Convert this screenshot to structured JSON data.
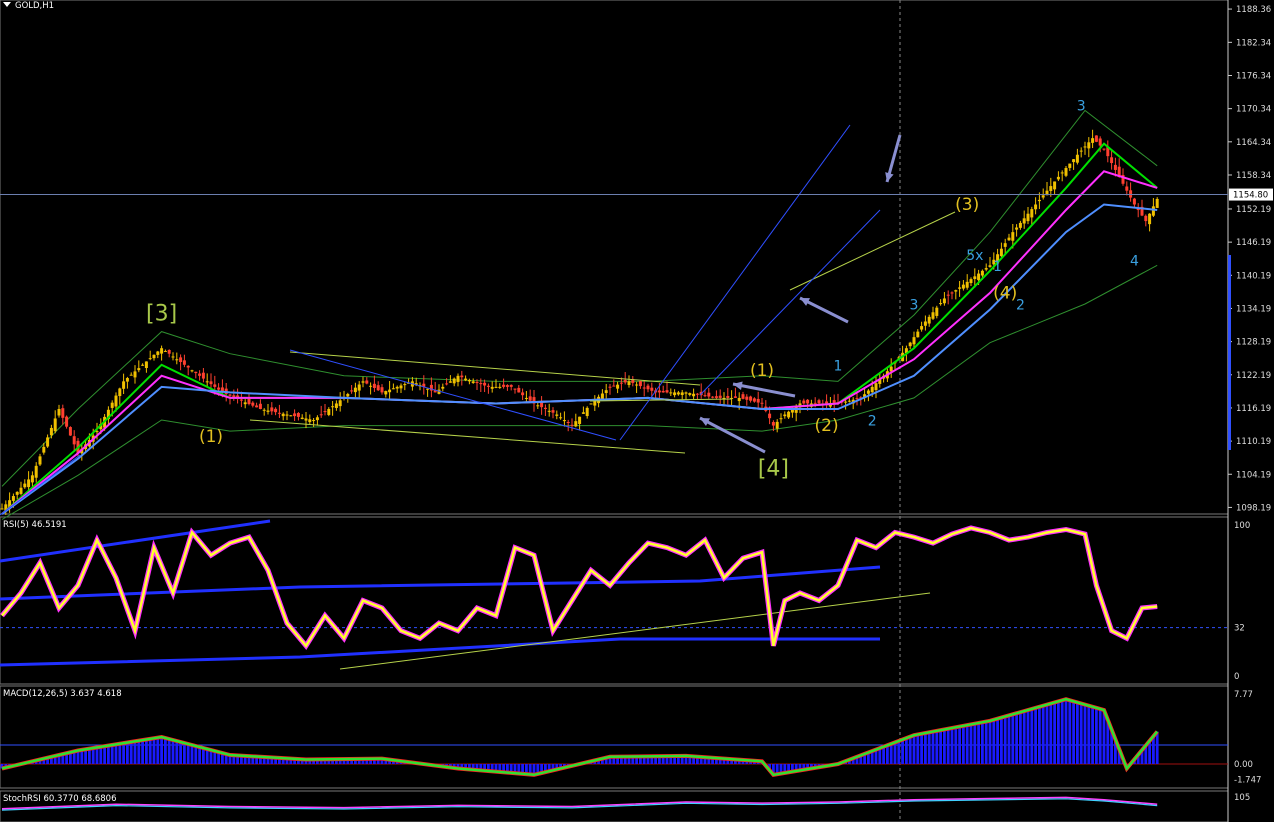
{
  "chart_data": [
    {
      "type": "candlestick",
      "title": "GOLD,H1",
      "price_ticks": [
        "1188.36",
        "1182.34",
        "1176.34",
        "1170.34",
        "1164.34",
        "1158.34",
        "1152.19",
        "1146.19",
        "1140.19",
        "1134.19",
        "1128.19",
        "1122.19",
        "1116.19",
        "1110.19",
        "1104.19",
        "1098.19"
      ],
      "price_tick_values": [
        1188.36,
        1182.34,
        1176.34,
        1170.34,
        1164.34,
        1158.34,
        1152.19,
        1146.19,
        1140.19,
        1134.19,
        1128.19,
        1122.19,
        1116.19,
        1110.19,
        1104.19,
        1098.19
      ],
      "current_price": "1154.80",
      "current_price_value": 1154.8,
      "ylim": [
        1097.0,
        1190.0
      ],
      "price_path": [
        [
          0,
          1098
        ],
        [
          8,
          1104
        ],
        [
          15,
          1116
        ],
        [
          20,
          1108
        ],
        [
          25,
          1112
        ],
        [
          32,
          1121
        ],
        [
          42,
          1127
        ],
        [
          50,
          1123
        ],
        [
          58,
          1119
        ],
        [
          68,
          1116
        ],
        [
          75,
          1115
        ],
        [
          82,
          1114
        ],
        [
          88,
          1117
        ],
        [
          95,
          1121
        ],
        [
          100,
          1119
        ],
        [
          108,
          1121
        ],
        [
          114,
          1119
        ],
        [
          120,
          1122
        ],
        [
          128,
          1120
        ],
        [
          134,
          1120
        ],
        [
          140,
          1117
        ],
        [
          146,
          1115
        ],
        [
          150,
          1113
        ],
        [
          155,
          1117
        ],
        [
          160,
          1120
        ],
        [
          165,
          1121
        ],
        [
          172,
          1119
        ],
        [
          180,
          1119
        ],
        [
          188,
          1118
        ],
        [
          194,
          1118
        ],
        [
          200,
          1117
        ],
        [
          203,
          1113
        ],
        [
          206,
          1115
        ],
        [
          210,
          1117
        ],
        [
          215,
          1117
        ],
        [
          220,
          1117
        ],
        [
          226,
          1118
        ],
        [
          232,
          1122
        ],
        [
          238,
          1127
        ],
        [
          242,
          1131
        ],
        [
          248,
          1136
        ],
        [
          254,
          1139
        ],
        [
          260,
          1142
        ],
        [
          266,
          1148
        ],
        [
          272,
          1153
        ],
        [
          278,
          1158
        ],
        [
          283,
          1162
        ],
        [
          287,
          1165
        ],
        [
          290,
          1163
        ],
        [
          294,
          1158
        ],
        [
          298,
          1153
        ],
        [
          301,
          1150
        ],
        [
          304,
          1154
        ]
      ],
      "bands": {
        "upper": [
          [
            0,
            1102
          ],
          [
            20,
            1116
          ],
          [
            42,
            1130
          ],
          [
            60,
            1126
          ],
          [
            90,
            1122
          ],
          [
            130,
            1121
          ],
          [
            170,
            1121
          ],
          [
            200,
            1122
          ],
          [
            220,
            1121
          ],
          [
            240,
            1133
          ],
          [
            260,
            1148
          ],
          [
            285,
            1170
          ],
          [
            304,
            1160
          ]
        ],
        "lower": [
          [
            0,
            1096
          ],
          [
            20,
            1104
          ],
          [
            42,
            1114
          ],
          [
            60,
            1112
          ],
          [
            90,
            1113
          ],
          [
            130,
            1113
          ],
          [
            170,
            1113
          ],
          [
            200,
            1112
          ],
          [
            220,
            1114
          ],
          [
            240,
            1118
          ],
          [
            260,
            1128
          ],
          [
            285,
            1135
          ],
          [
            304,
            1142
          ]
        ]
      },
      "moving_averages": [
        {
          "color": "#00e000",
          "values": [
            [
              0,
              1097
            ],
            [
              20,
              1109
            ],
            [
              42,
              1124
            ],
            [
              60,
              1118
            ],
            [
              90,
              1118
            ],
            [
              130,
              1117
            ],
            [
              170,
              1118
            ],
            [
              200,
              1116
            ],
            [
              220,
              1117
            ],
            [
              240,
              1127
            ],
            [
              260,
              1141
            ],
            [
              280,
              1156
            ],
            [
              290,
              1164
            ],
            [
              304,
              1156
            ]
          ]
        },
        {
          "color": "#ff30ff",
          "values": [
            [
              0,
              1097
            ],
            [
              20,
              1108
            ],
            [
              42,
              1122
            ],
            [
              60,
              1118
            ],
            [
              90,
              1118
            ],
            [
              130,
              1117
            ],
            [
              170,
              1118
            ],
            [
              200,
              1116
            ],
            [
              220,
              1117
            ],
            [
              240,
              1125
            ],
            [
              260,
              1137
            ],
            [
              280,
              1152
            ],
            [
              290,
              1159
            ],
            [
              304,
              1156
            ]
          ]
        },
        {
          "color": "#4f8fff",
          "values": [
            [
              0,
              1097
            ],
            [
              20,
              1107
            ],
            [
              42,
              1120
            ],
            [
              60,
              1119
            ],
            [
              90,
              1118
            ],
            [
              130,
              1117
            ],
            [
              170,
              1118
            ],
            [
              200,
              1116
            ],
            [
              220,
              1116
            ],
            [
              240,
              1122
            ],
            [
              260,
              1134
            ],
            [
              280,
              1148
            ],
            [
              290,
              1153
            ],
            [
              304,
              1152
            ]
          ]
        }
      ],
      "wave_labels": [
        {
          "text": "[3]",
          "color": "#a8c84a",
          "x": 42,
          "y": 1132
        },
        {
          "text": "(1)",
          "color": "#e2c020",
          "x": 55,
          "y": 1110
        },
        {
          "text": "(1)",
          "color": "#e2c020",
          "x": 200,
          "y": 1122
        },
        {
          "text": "[4]",
          "color": "#a8c84a",
          "x": 203,
          "y": 1104
        },
        {
          "text": "(2)",
          "color": "#e2c020",
          "x": 217,
          "y": 1112
        },
        {
          "text": "(3)",
          "color": "#e2c020",
          "x": 254,
          "y": 1152
        },
        {
          "text": "(4)",
          "color": "#e2c020",
          "x": 264,
          "y": 1136
        },
        {
          "text": "1",
          "color": "#3aa0e0",
          "x": 220,
          "y": 1123
        },
        {
          "text": "2",
          "color": "#3aa0e0",
          "x": 229,
          "y": 1113
        },
        {
          "text": "3",
          "color": "#3aa0e0",
          "x": 240,
          "y": 1134
        },
        {
          "text": "5x",
          "color": "#3aa0e0",
          "x": 256,
          "y": 1143
        },
        {
          "text": "1",
          "color": "#3aa0e0",
          "x": 262,
          "y": 1141
        },
        {
          "text": "2",
          "color": "#3aa0e0",
          "x": 268,
          "y": 1134
        },
        {
          "text": "3",
          "color": "#3aa0e0",
          "x": 284,
          "y": 1170
        },
        {
          "text": "4",
          "color": "#3aa0e0",
          "x": 298,
          "y": 1142
        }
      ]
    },
    {
      "type": "line",
      "title": "RSI(5) 46.5191",
      "ticks": [
        "100",
        "32",
        "0"
      ],
      "tick_values": [
        100,
        32,
        0
      ],
      "ylim": [
        0,
        100
      ],
      "values": [
        [
          0,
          40
        ],
        [
          5,
          55
        ],
        [
          10,
          75
        ],
        [
          15,
          45
        ],
        [
          20,
          60
        ],
        [
          25,
          90
        ],
        [
          30,
          65
        ],
        [
          35,
          30
        ],
        [
          40,
          85
        ],
        [
          45,
          55
        ],
        [
          50,
          95
        ],
        [
          55,
          80
        ],
        [
          60,
          88
        ],
        [
          65,
          92
        ],
        [
          70,
          70
        ],
        [
          75,
          35
        ],
        [
          80,
          20
        ],
        [
          85,
          40
        ],
        [
          90,
          25
        ],
        [
          95,
          50
        ],
        [
          100,
          45
        ],
        [
          105,
          30
        ],
        [
          110,
          25
        ],
        [
          115,
          35
        ],
        [
          120,
          30
        ],
        [
          125,
          45
        ],
        [
          130,
          40
        ],
        [
          135,
          85
        ],
        [
          140,
          80
        ],
        [
          145,
          30
        ],
        [
          150,
          50
        ],
        [
          155,
          70
        ],
        [
          160,
          60
        ],
        [
          165,
          75
        ],
        [
          170,
          88
        ],
        [
          175,
          85
        ],
        [
          180,
          80
        ],
        [
          185,
          90
        ],
        [
          190,
          65
        ],
        [
          195,
          78
        ],
        [
          200,
          82
        ],
        [
          203,
          20
        ],
        [
          206,
          50
        ],
        [
          210,
          55
        ],
        [
          215,
          50
        ],
        [
          220,
          60
        ],
        [
          225,
          90
        ],
        [
          230,
          85
        ],
        [
          235,
          95
        ],
        [
          240,
          92
        ],
        [
          245,
          88
        ],
        [
          250,
          94
        ],
        [
          255,
          98
        ],
        [
          260,
          95
        ],
        [
          265,
          90
        ],
        [
          270,
          92
        ],
        [
          275,
          95
        ],
        [
          280,
          97
        ],
        [
          285,
          94
        ],
        [
          288,
          60
        ],
        [
          292,
          30
        ],
        [
          296,
          25
        ],
        [
          300,
          45
        ],
        [
          304,
          46
        ]
      ]
    },
    {
      "type": "bar",
      "title": "MACD(12,26,5) 3.637 4.618",
      "ticks": [
        "7.77",
        "0.00",
        "-1.747"
      ],
      "tick_values": [
        7.77,
        0.0,
        -1.747
      ],
      "ylim": [
        -2.0,
        8.0
      ],
      "values": [
        [
          0,
          -0.5
        ],
        [
          20,
          1.5
        ],
        [
          42,
          3.0
        ],
        [
          60,
          1.0
        ],
        [
          80,
          0.5
        ],
        [
          100,
          0.6
        ],
        [
          120,
          -0.5
        ],
        [
          140,
          -1.2
        ],
        [
          160,
          0.8
        ],
        [
          180,
          0.9
        ],
        [
          200,
          0.3
        ],
        [
          203,
          -1.2
        ],
        [
          220,
          0.0
        ],
        [
          240,
          3.2
        ],
        [
          260,
          4.8
        ],
        [
          280,
          7.2
        ],
        [
          290,
          6.0
        ],
        [
          296,
          -0.5
        ],
        [
          304,
          3.6
        ]
      ]
    },
    {
      "type": "line",
      "title": "StochRSI 60.3770 68.6806",
      "ticks": [
        "105"
      ],
      "tick_values": [
        105
      ],
      "ylim": [
        -5,
        105
      ],
      "values": [
        [
          0,
          40
        ],
        [
          30,
          60
        ],
        [
          60,
          50
        ],
        [
          90,
          45
        ],
        [
          120,
          55
        ],
        [
          150,
          50
        ],
        [
          180,
          70
        ],
        [
          200,
          65
        ],
        [
          220,
          70
        ],
        [
          240,
          80
        ],
        [
          260,
          85
        ],
        [
          280,
          90
        ],
        [
          290,
          80
        ],
        [
          304,
          60
        ]
      ]
    }
  ]
}
